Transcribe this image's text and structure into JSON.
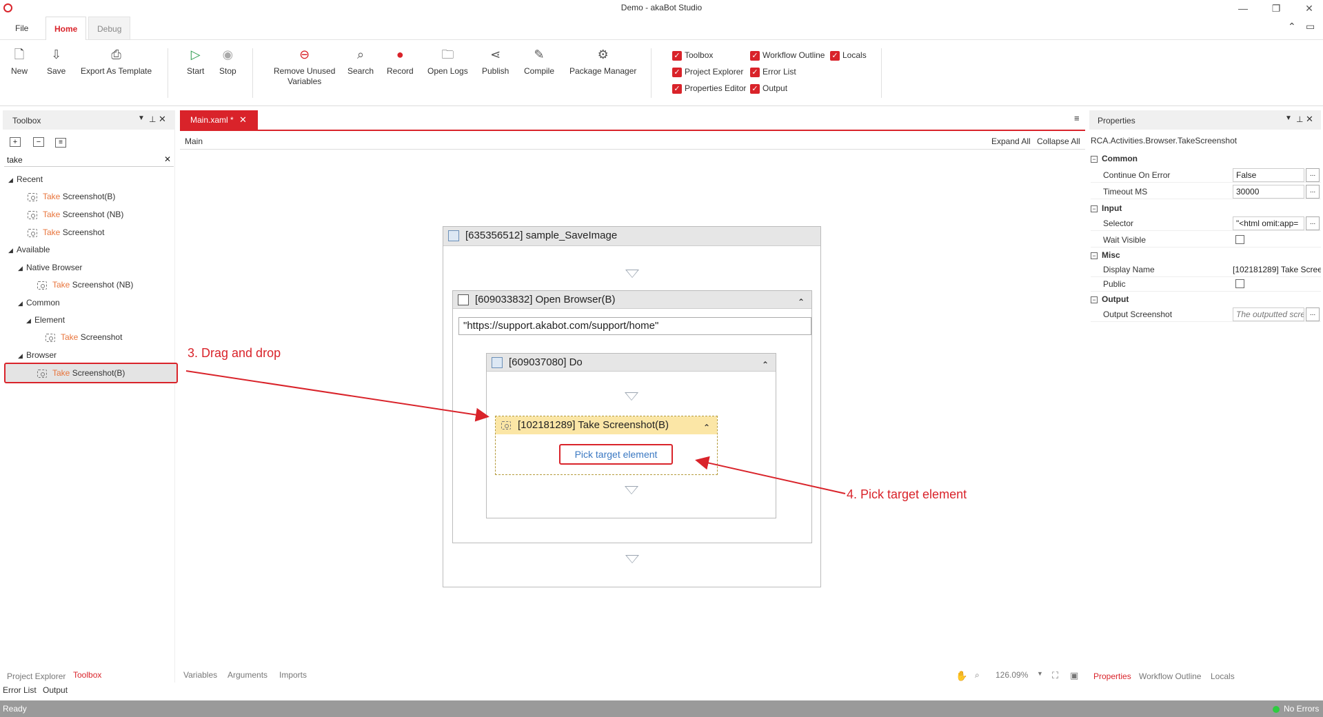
{
  "window": {
    "title": "Demo - akaBot Studio"
  },
  "menu_tabs": [
    "File",
    "Home",
    "Debug"
  ],
  "ribbon": {
    "new": "New",
    "save": "Save",
    "export": "Export As Template",
    "start": "Start",
    "stop": "Stop",
    "remove_unused_1": "Remove Unused",
    "remove_unused_2": "Variables",
    "search": "Search",
    "record": "Record",
    "open_logs": "Open Logs",
    "publish": "Publish",
    "compile": "Compile",
    "package_manager": "Package Manager",
    "checks": {
      "toolbox": "Toolbox",
      "project_explorer": "Project Explorer",
      "properties_editor": "Properties Editor",
      "workflow_outline": "Workflow Outline",
      "error_list": "Error List",
      "output": "Output",
      "locals": "Locals"
    }
  },
  "toolbox": {
    "title": "Toolbox",
    "search_value": "take",
    "recent": "Recent",
    "recent_items": [
      {
        "hl": "Take",
        "rest": " Screenshot(B)"
      },
      {
        "hl": "Take",
        "rest": " Screenshot (NB)"
      },
      {
        "hl": "Take",
        "rest": " Screenshot"
      }
    ],
    "available": "Available",
    "native_browser": "Native Browser",
    "native_item": {
      "hl": "Take",
      "rest": " Screenshot (NB)"
    },
    "common": "Common",
    "element": "Element",
    "element_item": {
      "hl": "Take",
      "rest": " Screenshot"
    },
    "browser": "Browser",
    "browser_item": {
      "hl": "Take",
      "rest": " Screenshot(B)"
    }
  },
  "left_bottom_tabs": {
    "project_explorer": "Project Explorer",
    "toolbox": "Toolbox",
    "error_list": "Error List",
    "output": "Output"
  },
  "designer": {
    "tab": "Main.xaml *",
    "breadcrumb": "Main",
    "expand_all": "Expand All",
    "collapse_all": "Collapse All",
    "seq_outer": "[635356512] sample_SaveImage",
    "open_browser": "[609033832] Open Browser(B)",
    "url": "\"https://support.akabot.com/support/home\"",
    "do": "[609037080] Do",
    "take_screenshot": "[102181289] Take Screenshot(B)",
    "pick": "Pick target element",
    "bottom_tabs": {
      "variables": "Variables",
      "arguments": "Arguments",
      "imports": "Imports"
    },
    "zoom": "126.09%"
  },
  "annotations": {
    "step3": "3. Drag and drop",
    "step4": "4. Pick target element"
  },
  "properties": {
    "title": "Properties",
    "type": "RCA.Activities.Browser.TakeScreenshot",
    "groups": {
      "common": "Common",
      "input": "Input",
      "misc": "Misc",
      "output": "Output"
    },
    "continue_on_error": {
      "name": "Continue On Error",
      "value": "False"
    },
    "timeout": {
      "name": "Timeout MS",
      "value": "30000"
    },
    "selector": {
      "name": "Selector",
      "value": "\"<html omit:app="
    },
    "wait_visible": {
      "name": "Wait Visible"
    },
    "display_name": {
      "name": "Display Name",
      "value": "[102181289] Take Scree"
    },
    "public": {
      "name": "Public"
    },
    "output_screenshot": {
      "name": "Output Screenshot",
      "value": "The outputted scre"
    },
    "bottom_tabs": {
      "properties": "Properties",
      "workflow_outline": "Workflow Outline",
      "locals": "Locals"
    }
  },
  "status": {
    "left": "Ready",
    "right": "No Errors"
  },
  "colors": {
    "accent": "#d9232a",
    "highlight": "#e8743b",
    "link": "#3a78c2"
  }
}
